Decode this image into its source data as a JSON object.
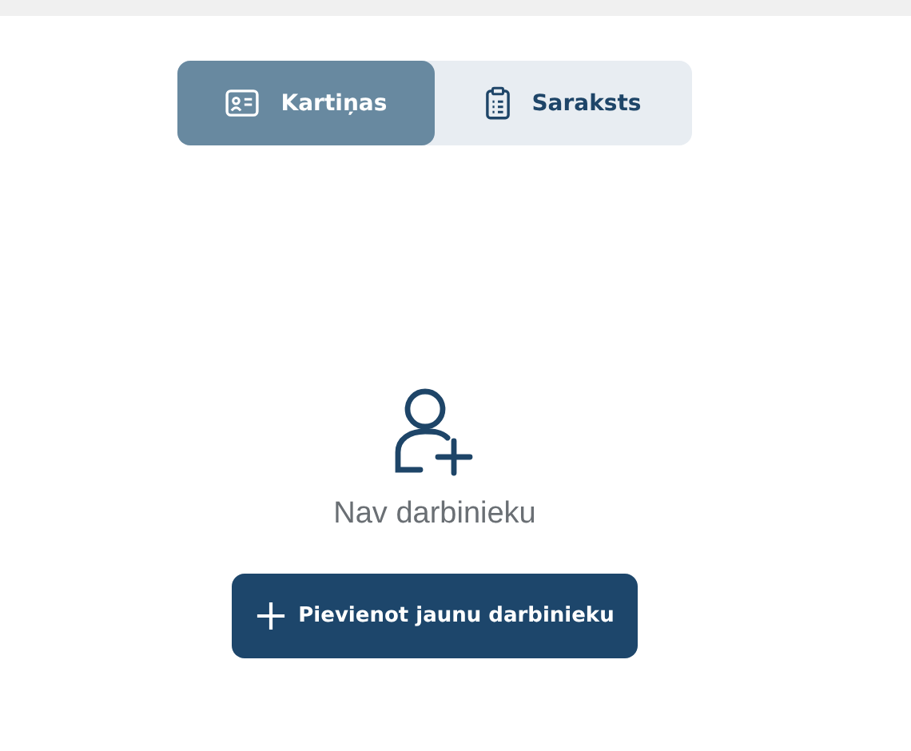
{
  "view_tabs": [
    {
      "label": "Kartiņas",
      "kind": "cards",
      "selected": true
    },
    {
      "label": "Saraksts",
      "kind": "list",
      "selected": false
    }
  ],
  "empty_state": {
    "message": "Nav darbinieku"
  },
  "add_button": {
    "label": "Pievienot jaunu darbinieku"
  }
}
